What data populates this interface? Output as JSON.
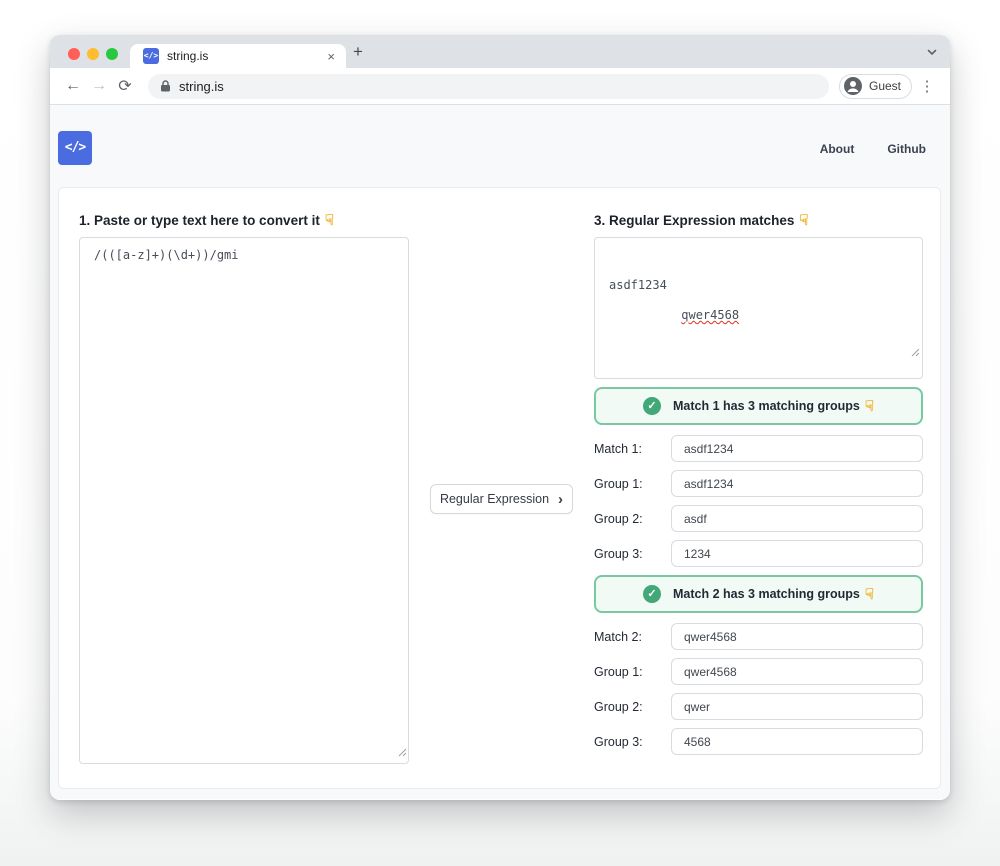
{
  "browser": {
    "tab": {
      "title": "string.is"
    },
    "address": "string.is",
    "profile_label": "Guest"
  },
  "site_nav": {
    "about": "About",
    "github": "Github"
  },
  "panels": {
    "input": {
      "heading": "1. Paste or type text here to convert it",
      "content": "/(([a-z]+)(\\d+))/gmi"
    },
    "converter": {
      "button_label": "Regular Expression"
    },
    "output": {
      "heading": "3. Regular Expression matches",
      "line1": "asdf1234",
      "line2": "qwer4568"
    }
  },
  "matches": [
    {
      "alert": "Match 1 has 3 matching groups",
      "rows": [
        {
          "label": "Match 1:",
          "value": "asdf1234"
        },
        {
          "label": "Group 1:",
          "value": "asdf1234"
        },
        {
          "label": "Group 2:",
          "value": "asdf"
        },
        {
          "label": "Group 3:",
          "value": "1234"
        }
      ]
    },
    {
      "alert": "Match 2 has 3 matching groups",
      "rows": [
        {
          "label": "Match 2:",
          "value": "qwer4568"
        },
        {
          "label": "Group 1:",
          "value": "qwer4568"
        },
        {
          "label": "Group 2:",
          "value": "qwer"
        },
        {
          "label": "Group 3:",
          "value": "4568"
        }
      ]
    }
  ],
  "icons": {
    "logo": "</>",
    "back": "←",
    "forward": "→",
    "reload": "⟳",
    "close": "×",
    "new_tab": "+",
    "menu": "⋮",
    "check": "✓",
    "chevron_right": "›",
    "pointer_down": "☟"
  },
  "colors": {
    "accent_blue": "#4a6ce0",
    "success_green": "#42a878",
    "alert_background": "#f1faf5",
    "alert_border": "#79c8a1",
    "emoji_gold": "#f2b632",
    "tabstrip": "#dee1e6",
    "page_background": "#f8f9fb"
  }
}
